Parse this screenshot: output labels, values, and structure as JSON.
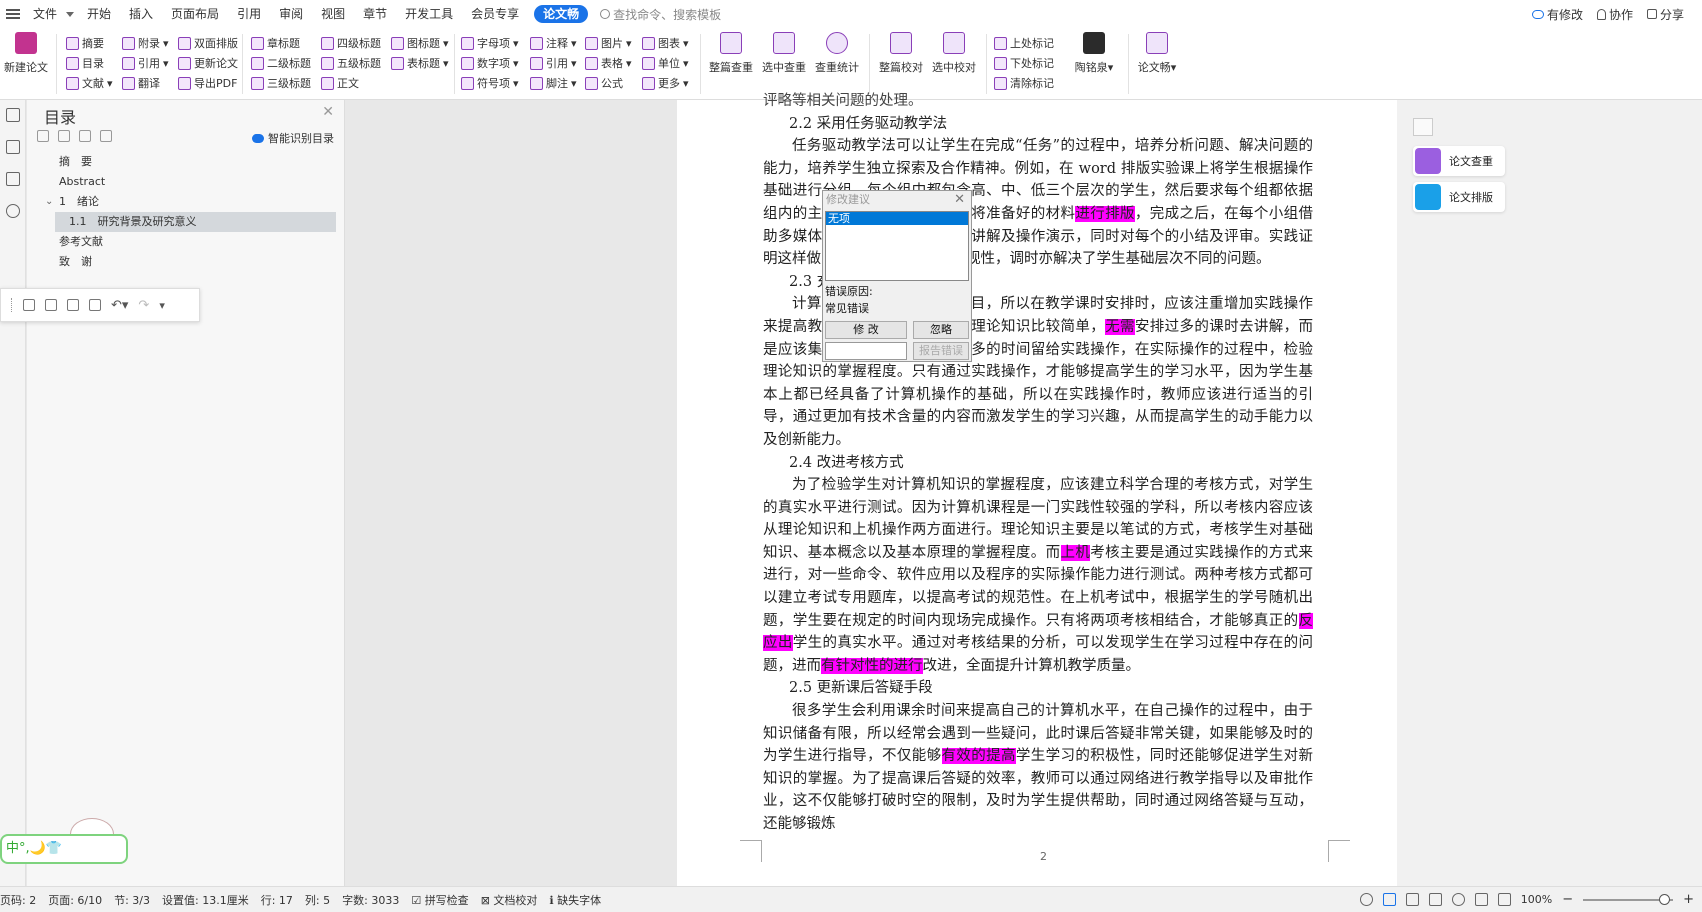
{
  "menubar": {
    "file": "文件",
    "tabs": [
      "开始",
      "插入",
      "页面布局",
      "引用",
      "审阅",
      "视图",
      "章节",
      "开发工具",
      "会员专享",
      "论文畅"
    ],
    "search_placeholder": "查找命令、搜索模板",
    "right": [
      "有修改",
      "协作",
      "分享"
    ]
  },
  "ribbon": {
    "new_paper": "新建论文",
    "col1": [
      "摘要",
      "目录",
      "文献"
    ],
    "col2": [
      "附录",
      "引用",
      "翻译"
    ],
    "col3": [
      "双面排版",
      "更新论文",
      "导出PDF"
    ],
    "col4": [
      "章标题",
      "二级标题",
      "三级标题"
    ],
    "col5": [
      "四级标题",
      "五级标题",
      "正文"
    ],
    "col6": [
      "图标题",
      "表标题"
    ],
    "col7": [
      "字母项",
      "数字项",
      "符号项"
    ],
    "col8": [
      "注释",
      "引用",
      "脚注"
    ],
    "col9": [
      "图片",
      "表格",
      "公式"
    ],
    "col10": [
      "图表",
      "单位",
      "更多"
    ],
    "check": [
      "整篇查重",
      "选中查重",
      "查重统计"
    ],
    "proof": [
      "整篇校对",
      "选中校对"
    ],
    "marks": [
      "上处标记",
      "下处标记",
      "清除标记"
    ],
    "user": "陶铭泉",
    "app": "论文畅"
  },
  "toc": {
    "title": "目录",
    "smart": "智能识别目录",
    "items": [
      "摘　要",
      "Abstract",
      "1　绪论",
      "1.1　研究背景及研究意义",
      "参考文献",
      "致　谢"
    ]
  },
  "doc": {
    "p0": "评略等相关问题的处理。",
    "h22": "2.2 采用任务驱动教学法",
    "p22a": "任务驱动教学法可以让学生在完成“任务”的过程中，培养分析问题、解决问题的能力，培养学生独立探索及合作精神。例如，在 word 排版实验课上将学生根据操作基础进行分组，每个组中都包含高、中、低三个层次的学生，然后要求每个组都依据组内的主流审美",
    "p22b": "，在规定时间内将准备好的材料",
    "hl1": "进行排版",
    "p22c": "，完成之后，在每个小组",
    "p22d": "借助多媒体设备对所有的同学进行讲解及操作演示，同时对每个",
    "p22e": "的小结及评审。实践证明这样做既充分发挥了学生的主观性，调",
    "p22f": "时亦解决了学生基础层次不同的问题。",
    "h23": "2.3 充",
    "p23a": "计算机",
    "p23b": "实践性要求较高的科目，所以在教学课时安排时，应该注重增加",
    "p23c": "实践操作来提高教学质量。计算机教学的理论知识比较简单，",
    "hl2": "无需",
    "p23d": "安排过多的课时去讲解，而是应该集中课时讲解理论，将更多的时间留给实践操作，在实际操作的过程中，检验理论知识的掌握程度。只有通过实践操作，才能够提高学生的学习水平，因为学生基本上都已经具备了计算机操作的基础，所以在实践操作时，教师应该进行适当的引导，通过更加有技术含量的内容而激发学生的学习兴趣，从而提高学生的动手能力以及创新能力。",
    "h24": "2.4 改进考核方式",
    "p24a": "为了检验学生对计算机知识的掌握程度，应该建立科学合理的考核方式，对学生的真实水平进行测试。因为计算机课程是一门实践性较强的学科，所以考核内容应该从理论知识和上机操作两方面进行。理论知识主要是以笔试的方式，考核学生对基础知识、基本概念以及基本原理的掌握程度。而",
    "hl3": "上机",
    "p24b": "考核主要是通过实践操作的方式来进行，对一些命令、软件应用以及程序的实际操作能力进行测试。两种考核方式都可以建立考试专用题库，以提高考试的规范性。在上机考试中，根据学生的学号随机出题，学生要在规定的时间内现场完成操作。只有将两项考核相结合，才能够真正的",
    "hl4": "反应出",
    "p24c": "学生的真实水平。通过对考核结果的分析，可以发现学生在学习过程中存在的问题，进而",
    "hl5": "有针对性的进行",
    "p24d": "改进，全面提升计算机教学质量。",
    "h25": "2.5 更新课后答疑手段",
    "p25a": "很多学生会利用课余时间来提高自己的计算机水平，在自己操作的过程中，由于知识储备有限，所以经常会遇到一些疑问，此时课后答疑非常关键，如果能够及时的为学生进行指导，不仅能够",
    "hl6": "有效的提高",
    "p25b": "学生学习的积极性，同时还能够促进学生对新知识的掌握。为了提高课后答疑的效率，教师可以通过网络进行教学指导以及审批作业，这不仅能够打破时空的限制，及时为学生提供帮助，同时通过网络答疑与互动，还能够锻炼",
    "page_no": "2"
  },
  "dialog": {
    "title": "修改建议",
    "option": "无项",
    "reason_label": "错误原因:",
    "reason": "常见错误",
    "fix": "修 改",
    "ignore": "忽略",
    "report": "报告错误"
  },
  "right_panel": {
    "check": "论文查重",
    "format": "论文排版"
  },
  "statusbar": {
    "items": [
      "页码: 2",
      "页面: 6/10",
      "节: 3/3",
      "设置值: 13.1厘米",
      "行: 17",
      "列: 5",
      "字数: 3033",
      "拼写检查",
      "文档校对",
      "缺失字体"
    ],
    "zoom": "100%"
  },
  "mascot_text": "中°,🌙👕"
}
